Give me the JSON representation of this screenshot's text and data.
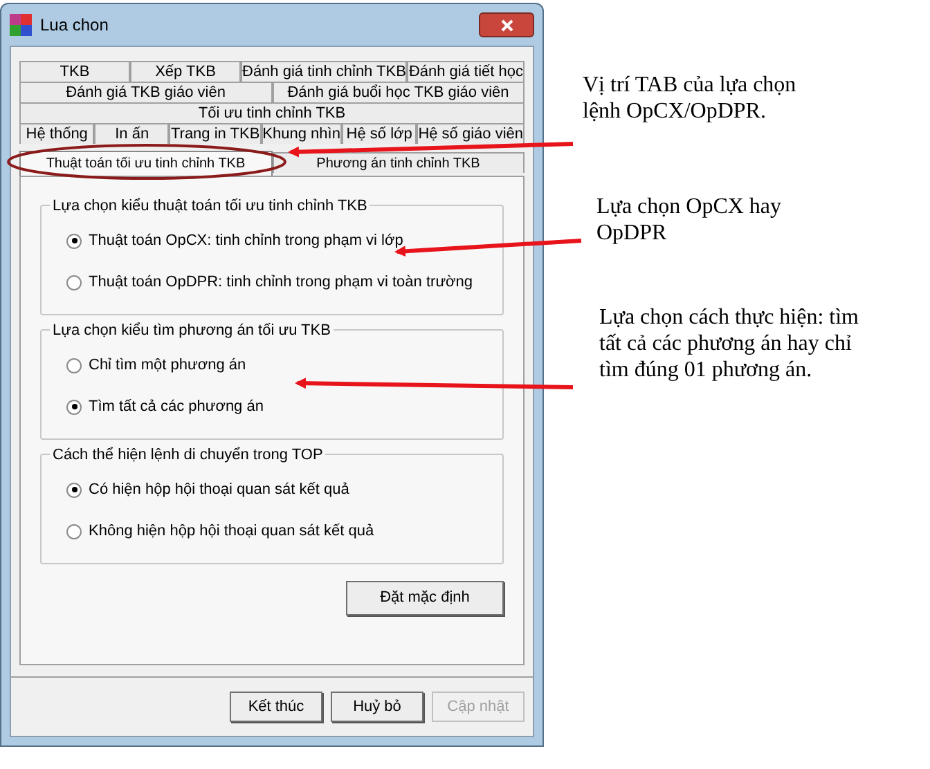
{
  "window": {
    "title": "Lua chon"
  },
  "tab_rows": [
    [
      {
        "label": "TKB",
        "selected": false
      },
      {
        "label": "Xếp TKB",
        "selected": false
      },
      {
        "label": "Đánh giá tinh chỉnh TKB",
        "selected": false
      },
      {
        "label": "Đánh giá tiết học",
        "selected": false
      }
    ],
    [
      {
        "label": "Đánh giá TKB giáo viên",
        "selected": false
      },
      {
        "label": "Đánh giá buổi học TKB giáo viên",
        "selected": false
      }
    ],
    [
      {
        "label": "Tối ưu tinh chỉnh TKB",
        "selected": false
      }
    ],
    [
      {
        "label": "Hệ thống",
        "selected": false
      },
      {
        "label": "In ấn",
        "selected": false
      },
      {
        "label": "Trang in TKB",
        "selected": false
      },
      {
        "label": "Khung nhìn",
        "selected": false
      },
      {
        "label": "Hệ số lớp",
        "selected": false
      },
      {
        "label": "Hệ số giáo viên",
        "selected": false
      }
    ],
    [
      {
        "label": "Thuật toán tối ưu tinh chỉnh TKB",
        "selected": true
      },
      {
        "label": "Phương án tinh chỉnh TKB",
        "selected": false
      }
    ]
  ],
  "groups": [
    {
      "title": "Lựa chọn kiểu thuật toán tối ưu tinh chỉnh TKB",
      "options": [
        {
          "label": "Thuật toán OpCX: tinh chỉnh trong phạm vi lớp",
          "selected": true
        },
        {
          "label": "Thuật toán OpDPR: tinh chỉnh trong phạm vi toàn trường",
          "selected": false
        }
      ]
    },
    {
      "title": "Lựa chọn kiểu tìm phương án tối ưu TKB",
      "options": [
        {
          "label": "Chỉ tìm một phương án",
          "selected": false
        },
        {
          "label": "Tìm tất cả các phương án",
          "selected": true
        }
      ]
    },
    {
      "title": "Cách thể hiện lệnh di chuyển trong TOP",
      "options": [
        {
          "label": "Có hiện hộp hội thoại quan sát kết quả",
          "selected": true
        },
        {
          "label": "Không hiện hộp hội thoại quan sát kết quả",
          "selected": false
        }
      ]
    }
  ],
  "default_button": "Đặt mặc định",
  "buttons": [
    {
      "label": "Kết thúc",
      "disabled": false
    },
    {
      "label": "Huỷ bỏ",
      "disabled": false
    },
    {
      "label": "Cập nhật",
      "disabled": true
    }
  ],
  "annotations": [
    "Vị trí TAB của lựa chọn lệnh OpCX/OpDPR.",
    "Lựa chọn OpCX hay OpDPR",
    "Lựa chọn cách thực hiện: tìm tất cả các phương án hay chỉ tìm đúng 01 phương án."
  ]
}
